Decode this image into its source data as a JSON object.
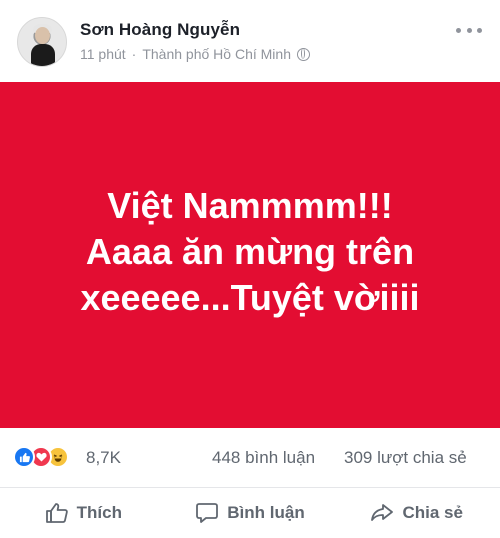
{
  "post": {
    "author": "Sơn Hoàng Nguyễn",
    "time": "11 phút",
    "separator": "·",
    "location": "Thành phố Hồ Chí Minh",
    "privacy_icon": "globe-icon",
    "more_icon": "more-icon",
    "status_text": "Việt Nammmm!!!\nAaaa ăn mừng trên\nxeeeee...Tuyệt vờiiii",
    "status_background": "#e30d32"
  },
  "stats": {
    "reaction_icons": [
      "like-icon",
      "love-icon",
      "haha-icon"
    ],
    "reaction_count": "8,7K",
    "comments": "448 bình luận",
    "shares": "309 lượt chia sẻ"
  },
  "actions": {
    "like_label": "Thích",
    "comment_label": "Bình luận",
    "share_label": "Chia sẻ"
  }
}
